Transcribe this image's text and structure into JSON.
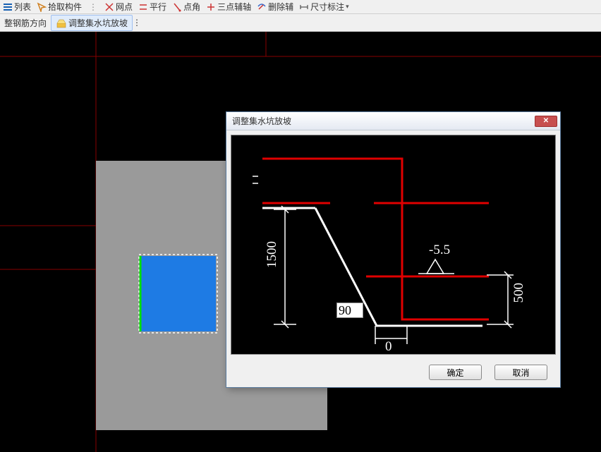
{
  "toolbar1": {
    "items": [
      {
        "label": "列表"
      },
      {
        "label": "拾取构件"
      },
      {
        "label": "网点"
      },
      {
        "label": "平行"
      },
      {
        "label": "点角"
      },
      {
        "label": "三点辅轴"
      },
      {
        "label": "删除辅"
      },
      {
        "label": "尺寸标注"
      }
    ]
  },
  "toolbar2": {
    "btn1": "整钢筋方向",
    "btn2": "调整集水坑放坡"
  },
  "dialog": {
    "title": "调整集水坑放坡",
    "dim_depth": "1500",
    "dim_right": "500",
    "dim_bottom": "0",
    "elevation": "-5.5",
    "angle_input": "90",
    "confirm": "确定",
    "cancel": "取消"
  }
}
